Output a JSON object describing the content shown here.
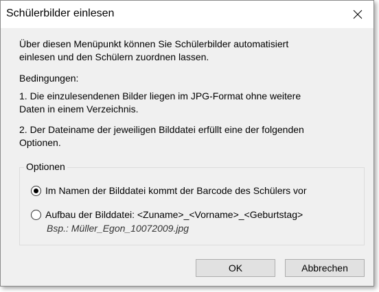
{
  "window": {
    "title": "Schülerbilder einlesen"
  },
  "content": {
    "intro_line1": "Über diesen Menüpunkt können Sie Schülerbilder automatisiert",
    "intro_line2": "einlesen und den Schülern zuordnen lassen.",
    "conditions_heading": "Bedingungen:",
    "condition1_line1": "1. Die einzulesendenen Bilder liegen im JPG-Format ohne weitere",
    "condition1_line2": "Daten in einem Verzeichnis.",
    "condition2_line1": "2. Der Dateiname der jeweiligen Bilddatei erfüllt eine der folgenden",
    "condition2_line2": "Optionen."
  },
  "options": {
    "legend": "Optionen",
    "option1_label": "Im Namen der Bilddatei kommt der Barcode des Schülers vor",
    "option1_checked": true,
    "option2_label": "Aufbau der Bilddatei: <Zuname>_<Vorname>_<Geburtstag>",
    "option2_checked": false,
    "option2_example": "Bsp.: Müller_Egon_10072009.jpg"
  },
  "buttons": {
    "ok_label": "OK",
    "cancel_label": "Abbrechen"
  },
  "icons": {
    "close": "close-icon"
  }
}
